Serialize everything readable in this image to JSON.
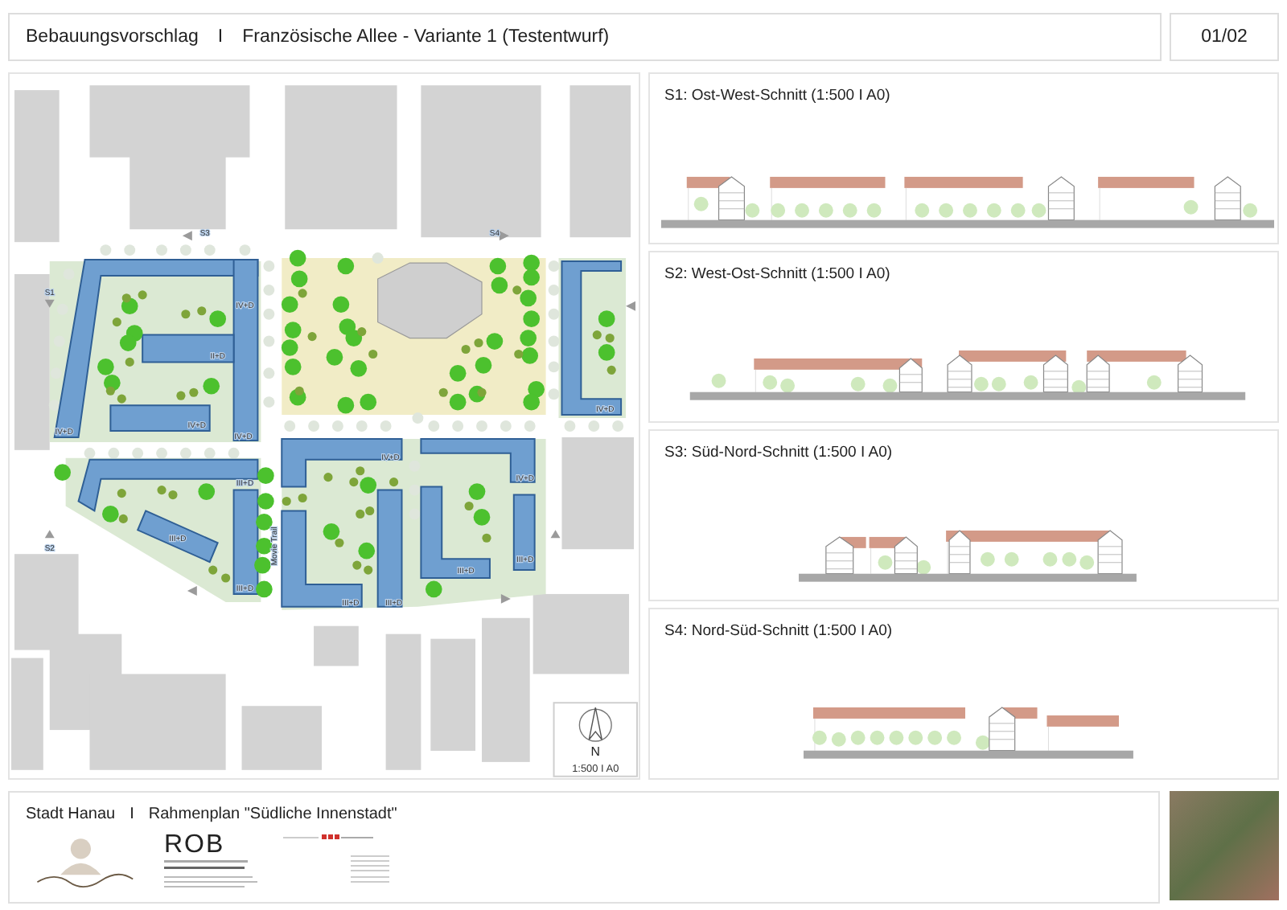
{
  "header": {
    "title": "Bebauungsvorschlag",
    "separator": "I",
    "subtitle": "Französische Allee - Variante 1 (Testentwurf)",
    "page": "01/02"
  },
  "site_plan": {
    "section_markers": [
      "S3",
      "S4",
      "S1",
      "S2"
    ],
    "building_labels": [
      "IV+D",
      "II+D",
      "IV+D",
      "IV+D",
      "IV+D",
      "IV+D",
      "IV+D",
      "IV+D",
      "III+D",
      "III+D",
      "III+D",
      "III+D",
      "III+D",
      "III+D",
      "III+D"
    ],
    "street_label": "Movie Trail",
    "north_letter": "N",
    "scale": "1:500 I A0"
  },
  "sections": [
    {
      "title": "S1: Ost-West-Schnitt (1:500 I A0)"
    },
    {
      "title": "S2: West-Ost-Schnitt (1:500 I A0)"
    },
    {
      "title": "S3: Süd-Nord-Schnitt (1:500 I A0)"
    },
    {
      "title": "S4: Nord-Süd-Schnitt (1:500 I A0)"
    }
  ],
  "footer": {
    "city": "Stadt Hanau",
    "separator": "I",
    "plan": "Rahmenplan \"Südliche Innenstadt\"",
    "logo_text": "ROB"
  }
}
